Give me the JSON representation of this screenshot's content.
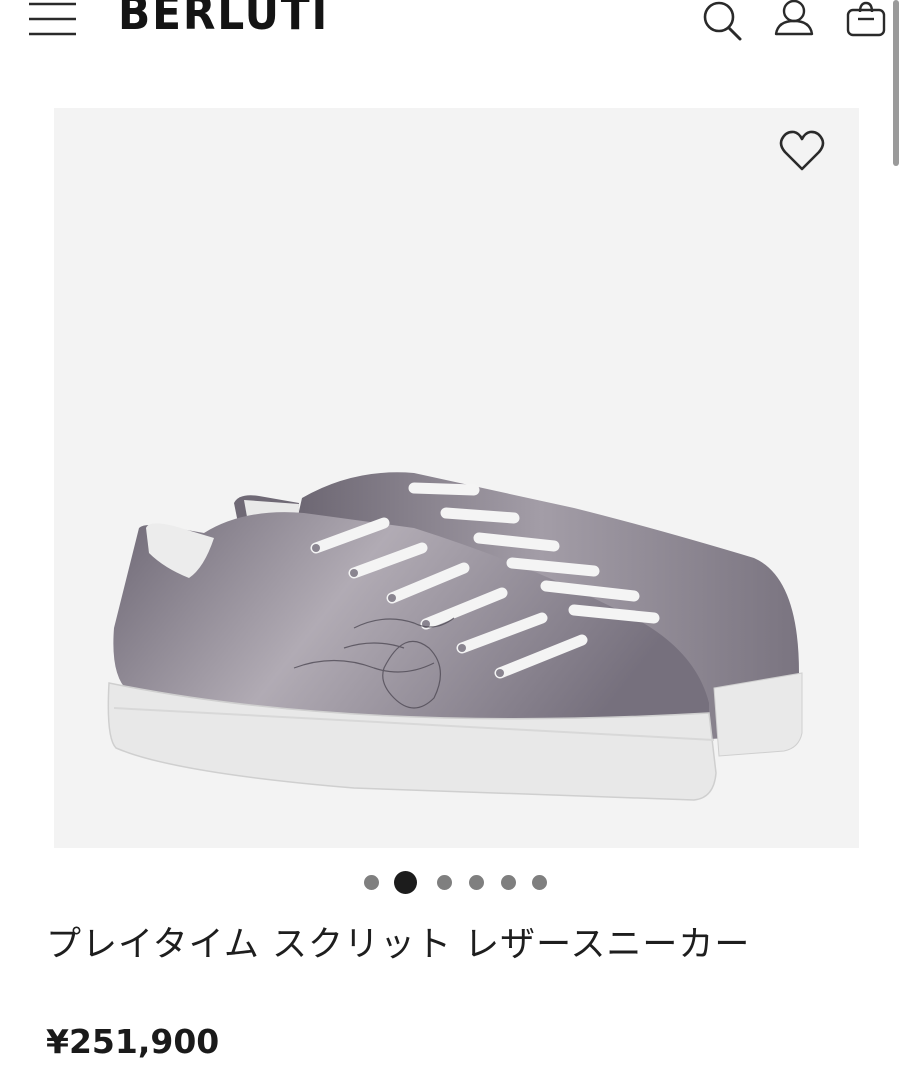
{
  "header": {
    "logo": "BERLUTI",
    "icons": [
      "menu-icon",
      "search-icon",
      "account-icon",
      "shopping-bag-icon"
    ]
  },
  "product": {
    "image_alt": "Playtime Scritto leather sneaker",
    "title": "プレイタイム スクリット レザースニーカー",
    "price": "¥251,900"
  },
  "carousel": {
    "total": 6,
    "active_index": 1
  },
  "colors": {
    "text": "#1a1a1a",
    "image_background": "#f3f3f3",
    "dot_inactive": "#7f7f7f",
    "dot_active": "#1c1c1c"
  }
}
